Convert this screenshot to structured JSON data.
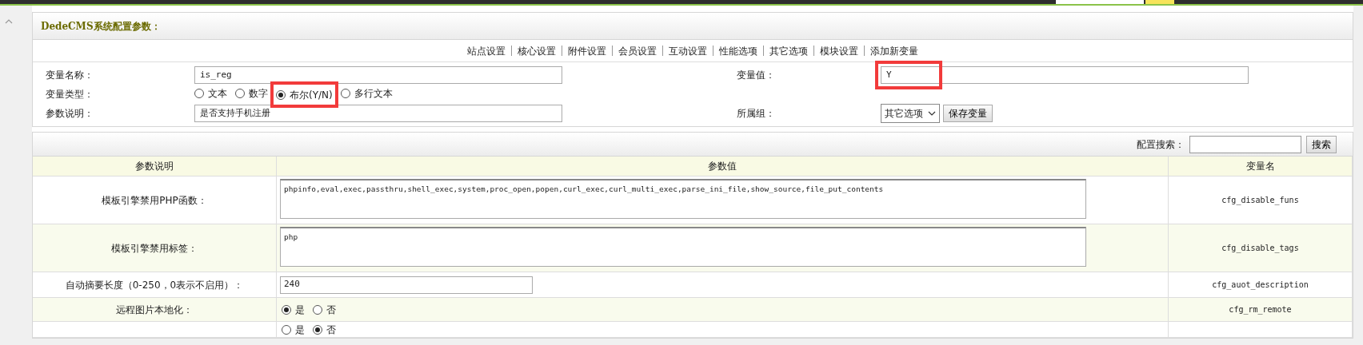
{
  "title": "DedeCMS系统配置参数：",
  "nav": [
    "站点设置",
    "核心设置",
    "附件设置",
    "会员设置",
    "互动设置",
    "性能选项",
    "其它选项",
    "模块设置",
    "添加新变量"
  ],
  "form": {
    "name_label": "变量名称：",
    "name_value": "is_reg",
    "value_label": "变量值：",
    "value": "Y",
    "value_highlighted": true,
    "type_label": "变量类型：",
    "types": [
      {
        "label": "文本",
        "selected": false,
        "highlighted": false
      },
      {
        "label": "数字",
        "selected": false,
        "highlighted": false
      },
      {
        "label": "布尔(Y/N)",
        "selected": true,
        "highlighted": true
      },
      {
        "label": "多行文本",
        "selected": false,
        "highlighted": false
      }
    ],
    "desc_label": "参数说明：",
    "desc_value": "是否支持手机注册",
    "group_label": "所属组：",
    "group_value": "其它选项",
    "save_button": "保存变量"
  },
  "search": {
    "label": "配置搜索：",
    "button": "搜索"
  },
  "table": {
    "columns": [
      "参数说明",
      "参数值",
      "变量名"
    ],
    "rows": [
      {
        "kind": "textarea",
        "label": "模板引擎禁用PHP函数：",
        "value": "phpinfo,eval,exec,passthru,shell_exec,system,proc_open,popen,curl_exec,curl_multi_exec,parse_ini_file,show_source,file_put_contents",
        "var": "cfg_disable_funs"
      },
      {
        "kind": "textarea",
        "label": "模板引擎禁用标签：",
        "value": "php",
        "var": "cfg_disable_tags"
      },
      {
        "kind": "text",
        "label": "自动摘要长度（0-250，0表示不启用）：",
        "value": "240",
        "var": "cfg_auot_description"
      },
      {
        "kind": "radio",
        "label": "远程图片本地化：",
        "options": [
          {
            "label": "是",
            "selected": true
          },
          {
            "label": "否",
            "selected": false
          }
        ],
        "var": "cfg_rm_remote"
      },
      {
        "kind": "radio",
        "options": [
          {
            "label": "是",
            "selected": false
          },
          {
            "label": "否",
            "selected": true
          }
        ]
      }
    ]
  }
}
